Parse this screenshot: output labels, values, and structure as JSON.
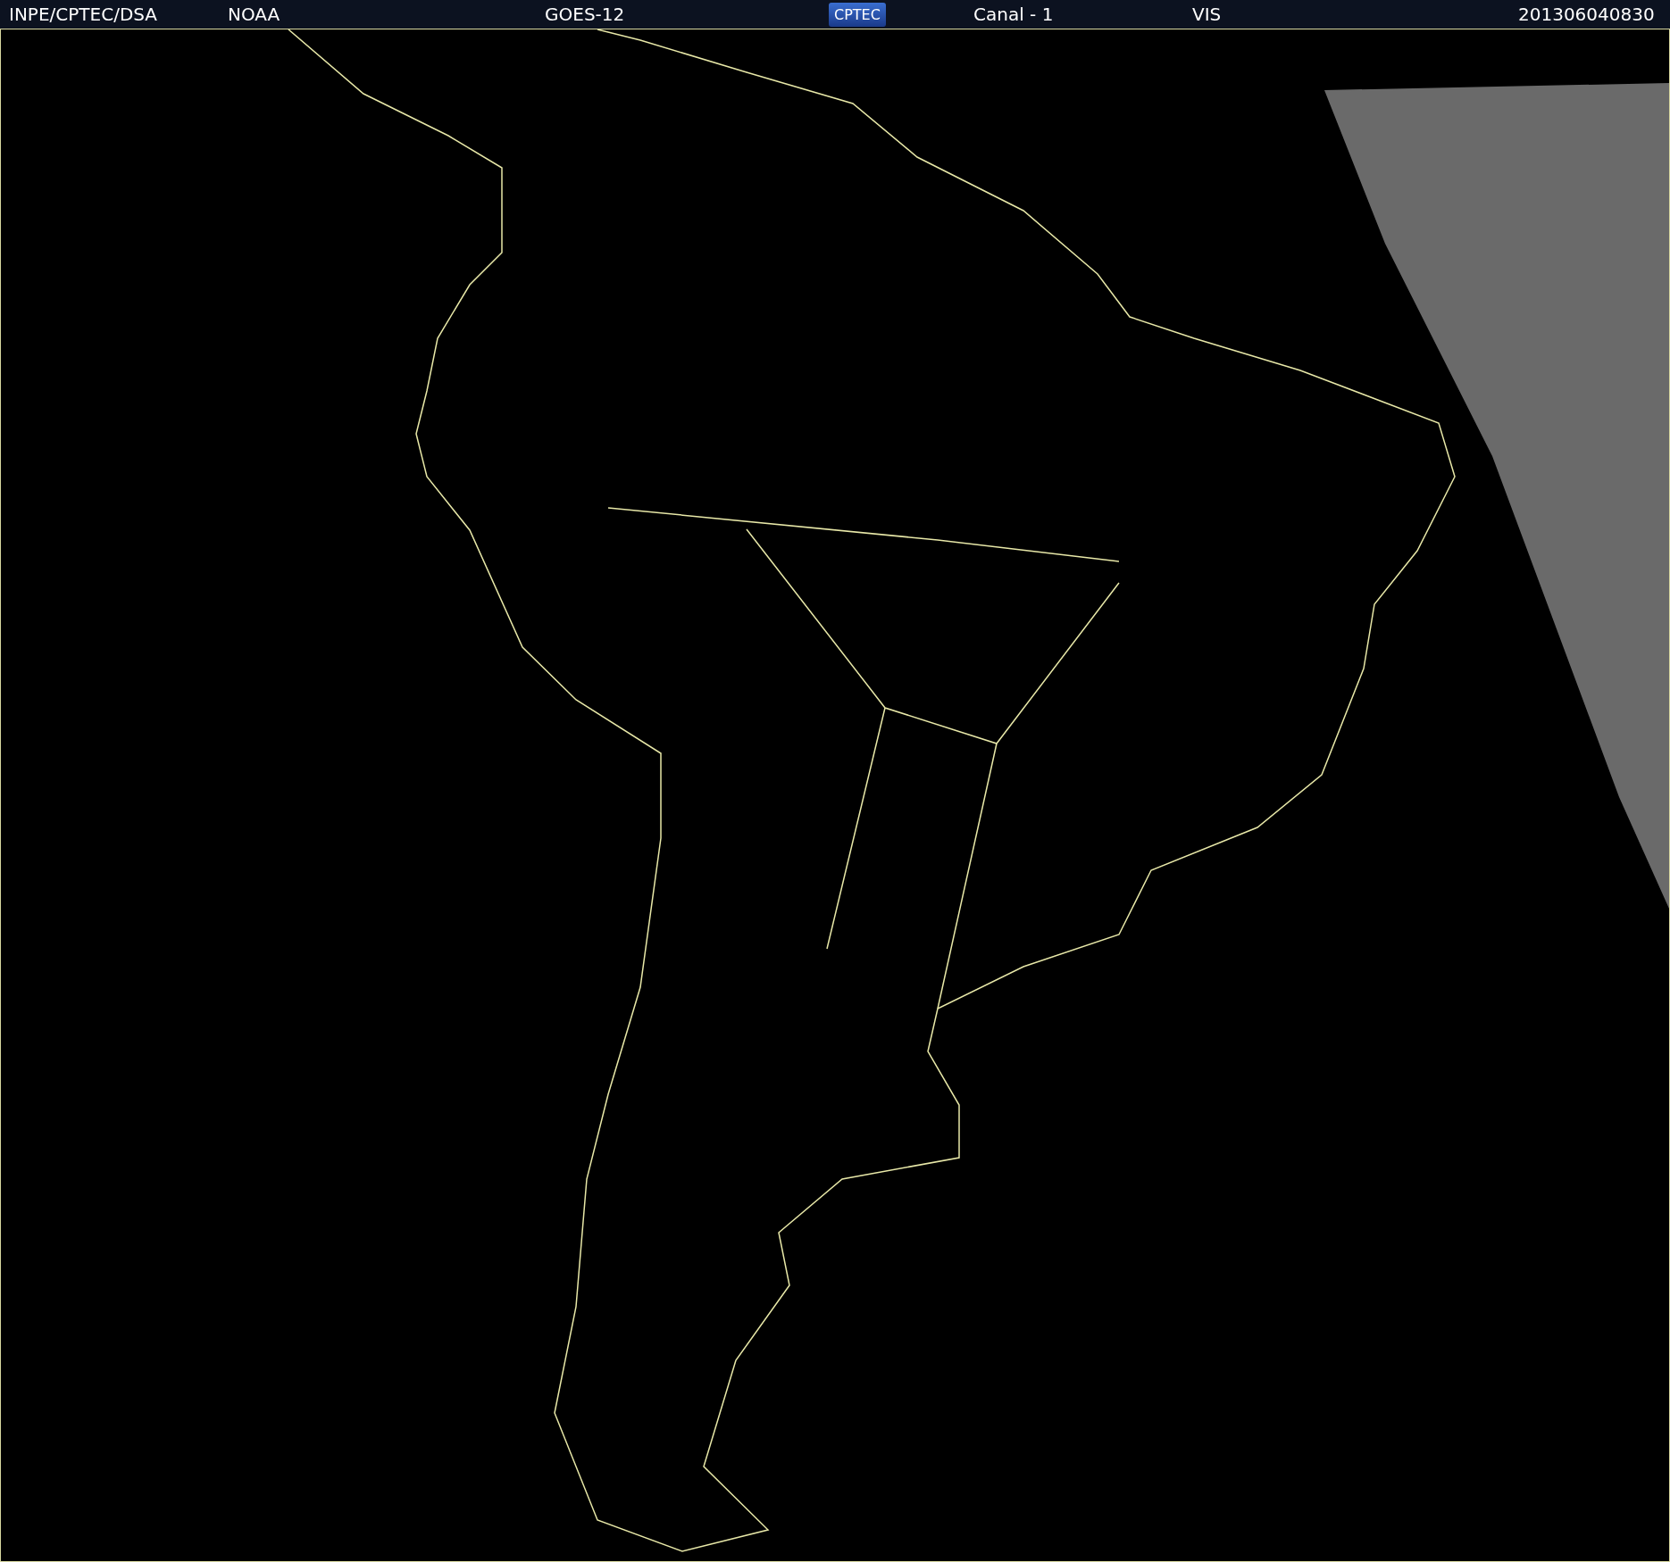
{
  "header": {
    "items": [
      {
        "kind": "text",
        "text": "INPE/CPTEC/DSA"
      },
      {
        "kind": "text",
        "text": "NOAA"
      },
      {
        "kind": "text",
        "text": "GOES-12"
      },
      {
        "kind": "logo",
        "text": "CPTEC"
      },
      {
        "kind": "text",
        "text": "Canal - 1"
      },
      {
        "kind": "text",
        "text": "VIS"
      },
      {
        "kind": "text",
        "text": "201306040830"
      }
    ]
  }
}
